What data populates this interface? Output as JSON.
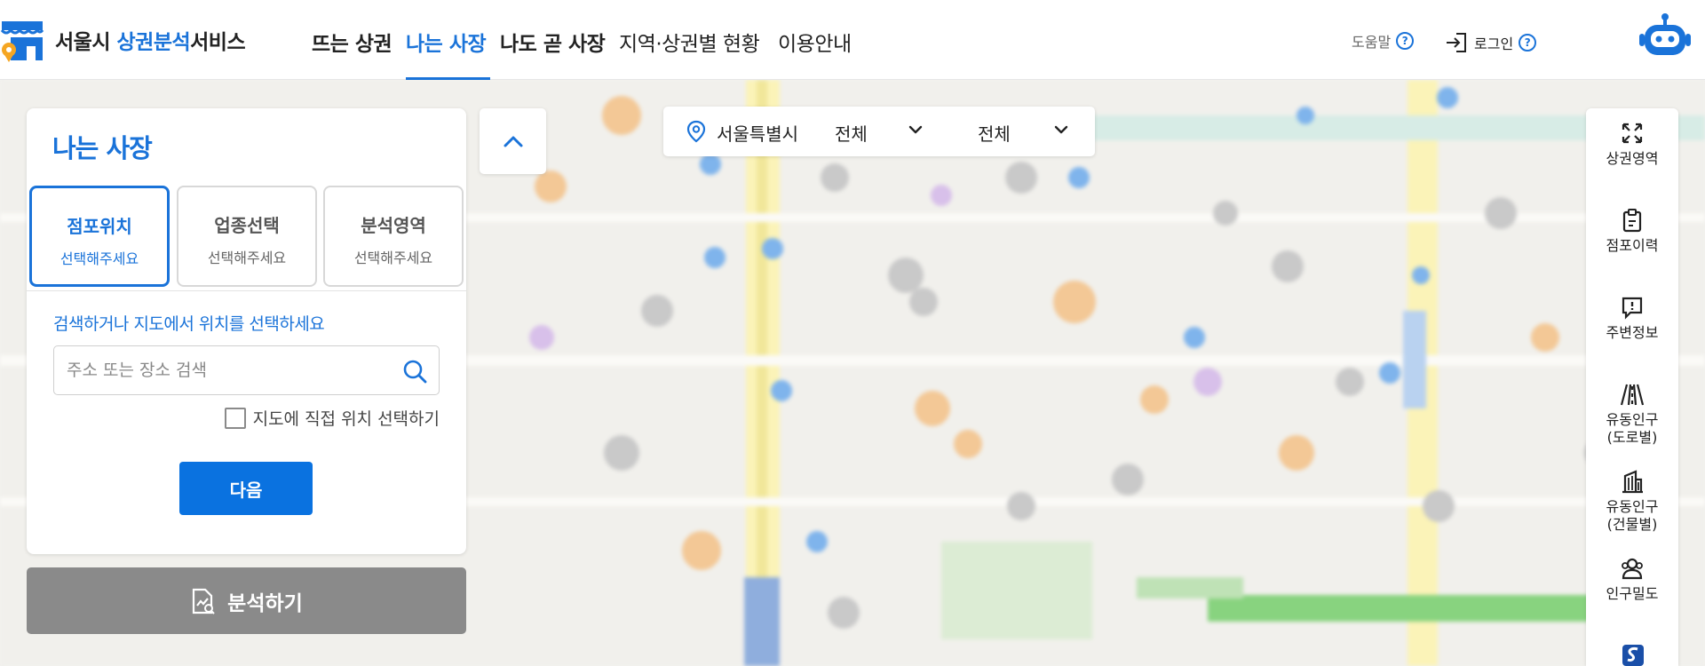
{
  "header": {
    "brand_prefix": "서울시 ",
    "brand_highlight": "상권분석",
    "brand_suffix": "서비스",
    "nav": [
      "뜨는 상권",
      "나는 사장",
      "나도 곧 사장",
      "지역·상권별 현황",
      "이용안내"
    ],
    "help_label": "도움말",
    "login_label": "로그인",
    "help_mark": "?"
  },
  "panel": {
    "title": "나는 사장",
    "steps": [
      {
        "title": "점포위치",
        "sub": "선택해주세요"
      },
      {
        "title": "업종선택",
        "sub": "선택해주세요"
      },
      {
        "title": "분석영역",
        "sub": "선택해주세요"
      }
    ],
    "guide": "검색하거나 지도에서 위치를 선택하세요",
    "search_placeholder": "주소 또는 장소 검색",
    "direct_select_label": "지도에 직접 위치 선택하기",
    "next_label": "다음"
  },
  "analyze_label": "분석하기",
  "region": {
    "city": "서울특별시",
    "district": "전체",
    "area": "전체"
  },
  "toolbar": {
    "items": [
      "상권영역",
      "점포이력",
      "주변정보",
      "유동인구\n(도로별)",
      "유동인구\n(건물별)",
      "인구밀도"
    ]
  },
  "colors": {
    "accent": "#1a73d9",
    "primary_button": "#0a72e0",
    "disabled_button": "#8a8a8a"
  }
}
